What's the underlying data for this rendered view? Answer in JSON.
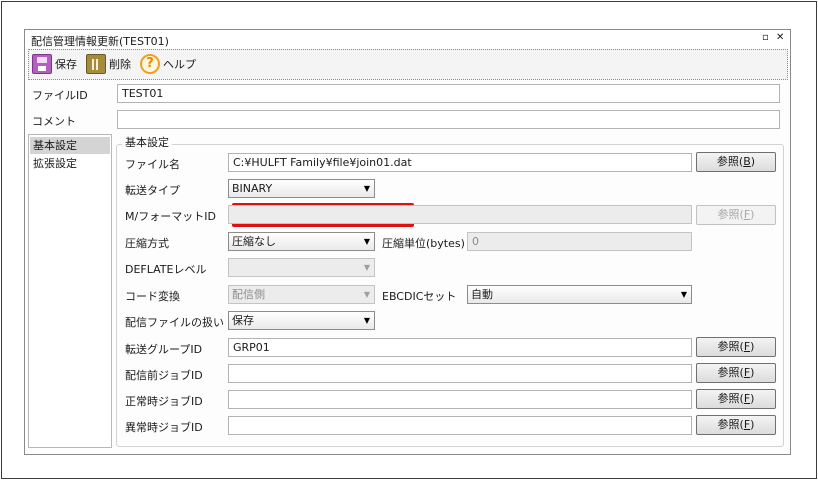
{
  "window": {
    "title": "配信管理情報更新(TEST01)",
    "restore_glyph": "▫",
    "close_glyph": "✕"
  },
  "toolbar": {
    "save_label": "保存",
    "delete_label": "削除",
    "help_label": "ヘルプ",
    "help_glyph": "?"
  },
  "header": {
    "file_id_label": "ファイルID",
    "file_id_value": "TEST01",
    "comment_label": "コメント",
    "comment_value": ""
  },
  "nav": {
    "items": [
      {
        "label": "基本設定",
        "active": true
      },
      {
        "label": "拡張設定",
        "active": false
      }
    ]
  },
  "basic": {
    "group_label": "基本設定",
    "file_name_label": "ファイル名",
    "file_name_value": "C:¥HULFT Family¥file¥join01.dat",
    "browse_b_label": "参照(",
    "browse_b_key": "B",
    "transfer_type_label": "転送タイプ",
    "transfer_type_value": "BINARY",
    "format_id_label": "M/フォーマットID",
    "format_id_value": "",
    "browse_f_label": "参照(",
    "browse_f_key": "F",
    "compress_label": "圧縮方式",
    "compress_value": "圧縮なし",
    "compress_unit_label": "圧縮単位(bytes)",
    "compress_unit_value": "0",
    "deflate_label": "DEFLATEレベル",
    "deflate_value": "",
    "code_conv_label": "コード変換",
    "code_conv_value": "配信側",
    "ebcdic_label": "EBCDICセット",
    "ebcdic_value": "自動",
    "file_handling_label": "配信ファイルの扱い",
    "file_handling_value": "保存",
    "group_id_label": "転送グループID",
    "group_id_value": "GRP01",
    "pre_job_label": "配信前ジョブID",
    "pre_job_value": "",
    "normal_job_label": "正常時ジョブID",
    "normal_job_value": "",
    "error_job_label": "異常時ジョブID",
    "error_job_value": "",
    "paren_close": ")"
  },
  "icons": {
    "dropdown_arrow": "▼"
  },
  "colors": {
    "highlight": "#e01010",
    "save_icon": "#b45ec4",
    "help_icon": "#f0a020"
  }
}
